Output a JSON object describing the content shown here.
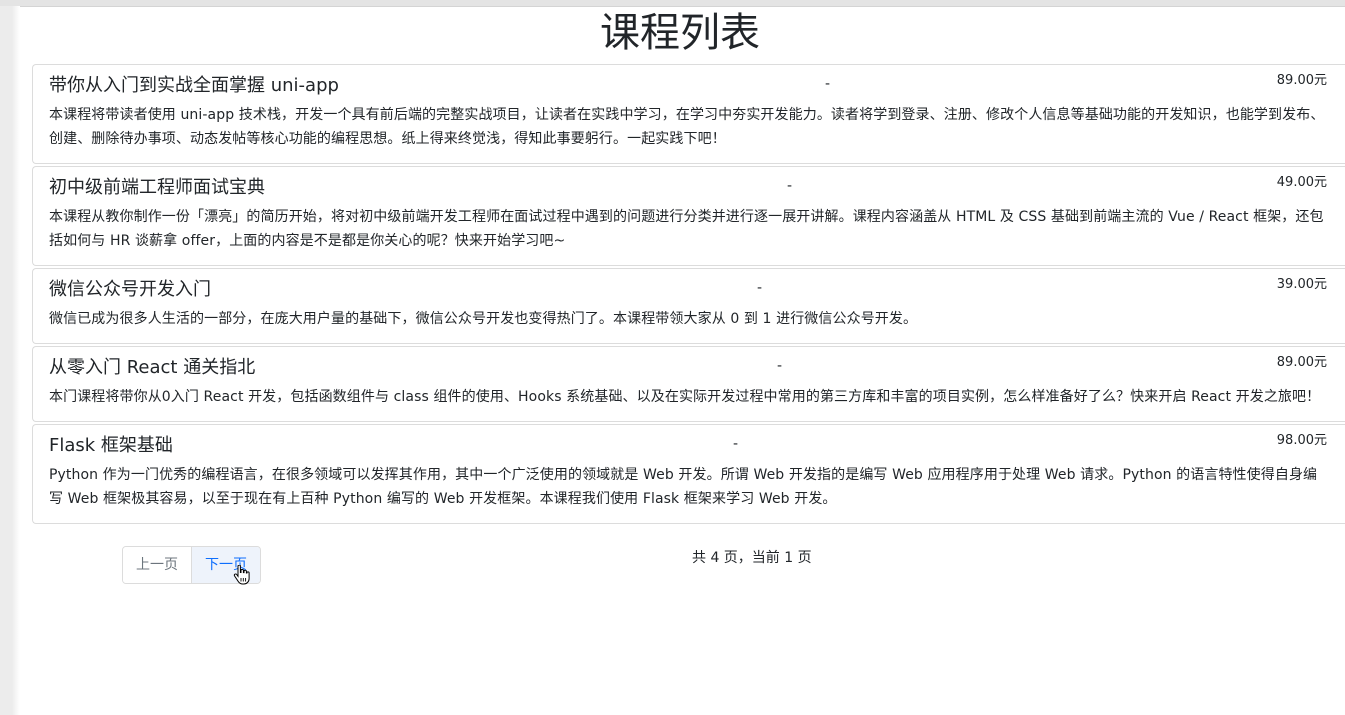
{
  "page": {
    "title": "课程列表"
  },
  "courses": [
    {
      "name": "带你从入门到实战全面掌握 uni-app",
      "separator": "-",
      "price": "89.00元",
      "description": "本课程将带读者使用 uni-app 技术栈，开发一个具有前后端的完整实战项目，让读者在实践中学习，在学习中夯实开发能力。读者将学到登录、注册、修改个人信息等基础功能的开发知识，也能学到发布、创建、删除待办事项、动态发帖等核心功能的编程思想。纸上得来终觉浅，得知此事要躬行。一起实践下吧！"
    },
    {
      "name": "初中级前端工程师面试宝典",
      "separator": "-",
      "price": "49.00元",
      "description": "本课程从教你制作一份「漂亮」的简历开始，将对初中级前端开发工程师在面试过程中遇到的问题进行分类并进行逐一展开讲解。课程内容涵盖从 HTML 及 CSS 基础到前端主流的 Vue / React 框架，还包括如何与 HR 谈薪拿 offer，上面的内容是不是都是你关心的呢？快来开始学习吧~"
    },
    {
      "name": "微信公众号开发入门",
      "separator": "-",
      "price": "39.00元",
      "description": "微信已成为很多人生活的一部分，在庞大用户量的基础下，微信公众号开发也变得热门了。本课程带领大家从 0 到 1 进行微信公众号开发。"
    },
    {
      "name": "从零入门 React 通关指北",
      "separator": "-",
      "price": "89.00元",
      "description": "本门课程将带你从0入门 React 开发，包括函数组件与 class 组件的使用、Hooks 系统基础、以及在实际开发过程中常用的第三方库和丰富的项目实例，怎么样准备好了么？快来开启 React 开发之旅吧！"
    },
    {
      "name": "Flask 框架基础",
      "separator": "-",
      "price": "98.00元",
      "description": "Python 作为一门优秀的编程语言，在很多领域可以发挥其作用，其中一个广泛使用的领域就是 Web 开发。所谓 Web 开发指的是编写 Web 应用程序用于处理 Web 请求。Python 的语言特性使得自身编写 Web 框架极其容易，以至于现在有上百种 Python 编写的 Web 开发框架。本课程我们使用 Flask 框架来学习 Web 开发。"
    }
  ],
  "pagination": {
    "prev_label": "上一页",
    "next_label": "下一页",
    "info": "共 4 页，当前 1 页"
  },
  "colors": {
    "link": "#0d6efd",
    "border": "#dcdcdc",
    "text": "#212529",
    "muted": "#6c757d"
  },
  "icons": {
    "cursor": "hand-pointer-icon"
  }
}
